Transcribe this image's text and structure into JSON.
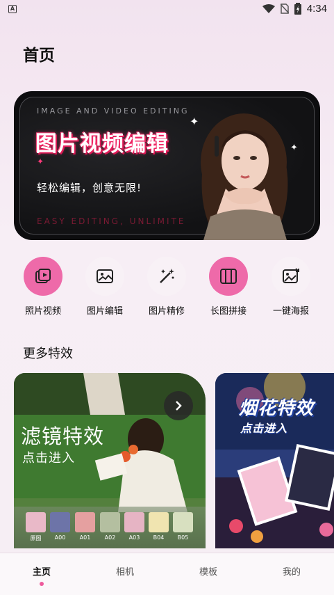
{
  "status_bar": {
    "time": "4:34",
    "app_badge": "A"
  },
  "page_title": "首页",
  "banner": {
    "top_text": "IMAGE AND VIDEO EDITING",
    "headline": "图片视频编辑",
    "subtitle": "轻松编辑，创意无限!",
    "bottom_text": "EASY EDITING, UNLIMITE"
  },
  "tools": [
    {
      "label": "照片视频",
      "icon": "photo-video-icon"
    },
    {
      "label": "图片编辑",
      "icon": "image-edit-icon"
    },
    {
      "label": "图片精修",
      "icon": "magic-wand-icon"
    },
    {
      "label": "长图拼接",
      "icon": "long-image-icon"
    },
    {
      "label": "一键海报",
      "icon": "poster-icon"
    }
  ],
  "section": {
    "title": "更多特效"
  },
  "effects": [
    {
      "title": "滤镜特效",
      "subtitle": "点击进入",
      "filters": [
        "原图",
        "A00",
        "A01",
        "A02",
        "A03",
        "B04",
        "B05"
      ]
    },
    {
      "title": "烟花特效",
      "subtitle": "点击进入"
    }
  ],
  "bottom_nav": [
    {
      "label": "主页",
      "active": true
    },
    {
      "label": "相机",
      "active": false
    },
    {
      "label": "模板",
      "active": false
    },
    {
      "label": "我的",
      "active": false
    }
  ],
  "colors": {
    "accent": "#ee6aa9",
    "banner_bg": "#0d0d0f"
  }
}
